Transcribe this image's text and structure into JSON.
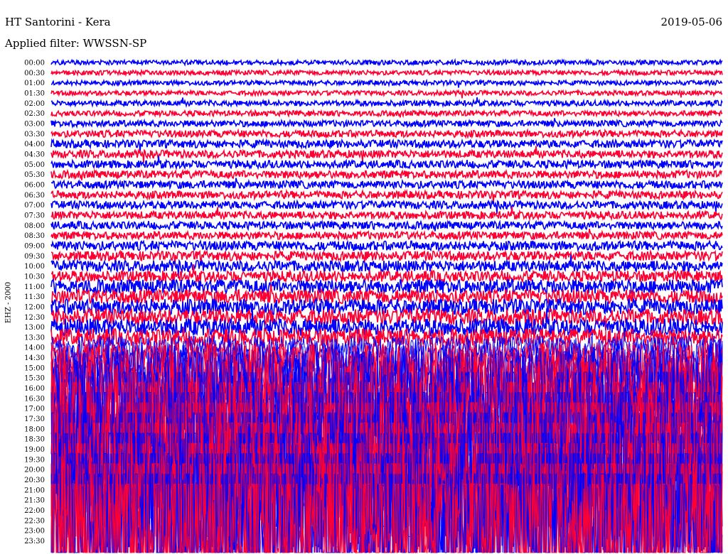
{
  "chart_data": {
    "type": "line",
    "title": "HT Santorini - Kera",
    "subtitle": "Applied filter: WWSSN-SP",
    "date": "2019-05-06",
    "ylabel": "EHZ - 2000",
    "xlabel": "",
    "row_labels": [
      "00:00",
      "00:30",
      "01:00",
      "01:30",
      "02:00",
      "02:30",
      "03:00",
      "03:30",
      "04:00",
      "04:30",
      "05:00",
      "05:30",
      "06:00",
      "06:30",
      "07:00",
      "07:30",
      "08:00",
      "08:30",
      "09:00",
      "09:30",
      "10:00",
      "10:30",
      "11:00",
      "11:30",
      "12:00",
      "12:30",
      "13:00",
      "13:30",
      "14:00",
      "14:30",
      "15:00",
      "15:30",
      "16:00",
      "16:30",
      "17:00",
      "17:30",
      "18:00",
      "18:30",
      "19:00",
      "19:30",
      "20:00",
      "20:30",
      "21:00",
      "21:30",
      "22:00",
      "22:30",
      "23:00",
      "23:30"
    ],
    "series": [
      {
        "color": "#0000ff"
      },
      {
        "color": "#ff0033"
      }
    ],
    "relative_amplitude": [
      0.06,
      0.06,
      0.06,
      0.06,
      0.07,
      0.07,
      0.08,
      0.09,
      0.1,
      0.1,
      0.1,
      0.1,
      0.1,
      0.1,
      0.1,
      0.1,
      0.1,
      0.1,
      0.12,
      0.12,
      0.14,
      0.14,
      0.18,
      0.18,
      0.2,
      0.2,
      0.22,
      0.22,
      0.3,
      0.4,
      0.6,
      0.9,
      1.2,
      1.5,
      1.8,
      2.0,
      2.2,
      2.4,
      2.5,
      2.6,
      2.7,
      2.8,
      2.9,
      3.0,
      3.1,
      3.2,
      3.3,
      3.4
    ],
    "grid": false,
    "legend": "none"
  }
}
